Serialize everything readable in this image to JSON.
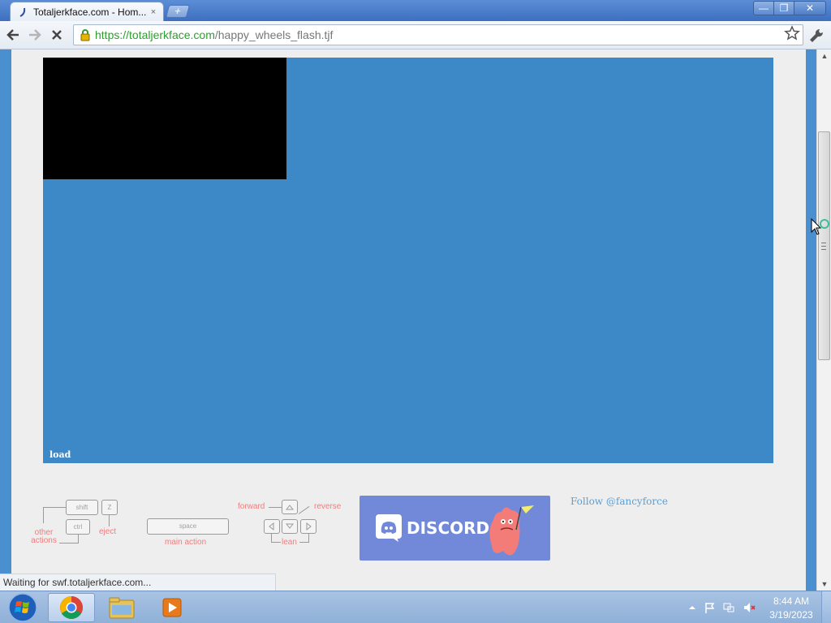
{
  "browser": {
    "tab": {
      "title": "Totaljerkface.com - Hom...",
      "close": "×"
    },
    "new_tab": "+",
    "window_buttons": {
      "minimize": "—",
      "maximize": "❐",
      "close": "✕"
    },
    "url": {
      "scheme": "https://",
      "host": "totaljerkface.com",
      "path": "/happy_wheels_flash.tjf"
    }
  },
  "page": {
    "game": {
      "load_label": "load",
      "background": "#3d88c7"
    },
    "controls": {
      "shift_key": "shift",
      "z_key": "Z",
      "ctrl_key": "ctrl",
      "other_actions": "other\nactions",
      "eject": "eject",
      "space_key": "space",
      "main_action": "main action",
      "forward": "forward",
      "reverse": "reverse",
      "lean": "lean"
    },
    "discord_label": "DISCORD",
    "follow_link": "Follow @fancyforce",
    "status_text": "Waiting for swf.totaljerkface.com..."
  },
  "taskbar": {
    "time": "8:44 AM",
    "date": "3/19/2023"
  }
}
